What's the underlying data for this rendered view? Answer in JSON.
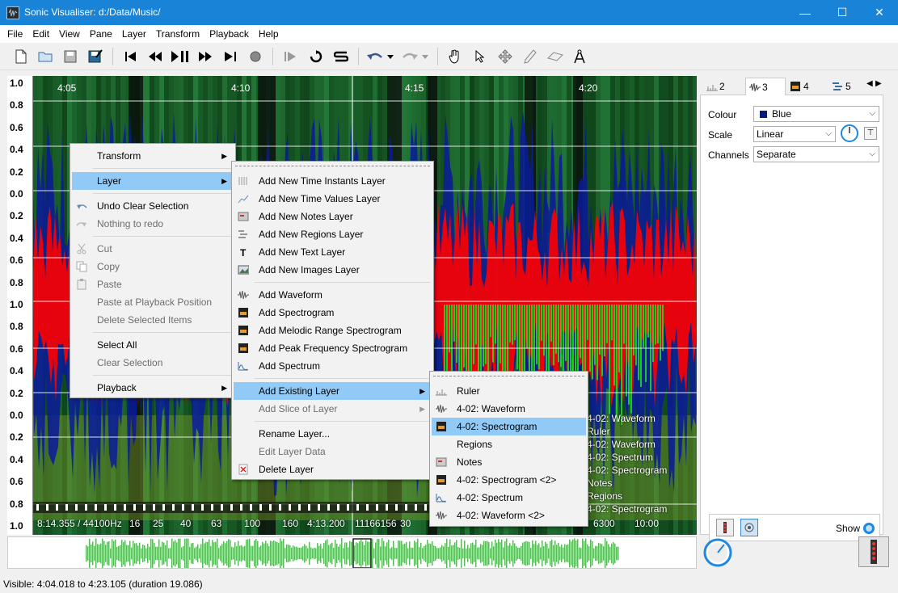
{
  "window": {
    "title": "Sonic Visualiser: d:/Data/Music/",
    "minimize": "—",
    "maximize": "☐",
    "close": "✕"
  },
  "menubar": [
    "File",
    "Edit",
    "View",
    "Pane",
    "Layer",
    "Transform",
    "Playback",
    "Help"
  ],
  "pane": {
    "time_labels": [
      "4:05",
      "4:10",
      "4:15",
      "4:20"
    ],
    "vruler_ticks": [
      "1.0",
      "0.8",
      "0.6",
      "0.4",
      "0.2",
      "0.0",
      "0.2",
      "0.4",
      "0.6",
      "0.8",
      "1.0",
      "0.8",
      "0.6",
      "0.4",
      "0.2",
      "0.0",
      "0.2",
      "0.4",
      "0.6",
      "0.8",
      "1.0"
    ],
    "bottom_readout": "8:14.355 / 44100Hz",
    "bottom_freqs": [
      "16",
      "25",
      "40",
      "63",
      "100",
      "160"
    ],
    "bottom_time": "4:13.200",
    "bottom_samples": "11166156",
    "bottom_tail": "30",
    "bottom_right": "6300",
    "bottom_right2": "10:00",
    "layer_labels_overlay": [
      "4-02: Waveform",
      "Ruler",
      "4-02: Waveform",
      "4-02: Spectrum",
      "4-02: Spectrogram",
      "Notes",
      "Regions",
      "4-02: Spectrogram"
    ]
  },
  "right_panel": {
    "tabs": [
      "2",
      "3",
      "4",
      "5"
    ],
    "colour_label": "Colour",
    "colour_value": "Blue",
    "scale_label": "Scale",
    "scale_value": "Linear",
    "channels_label": "Channels",
    "channels_value": "Separate",
    "show_label": "Show"
  },
  "status": "Visible: 4:04.018 to 4:23.105 (duration 19.086)",
  "context_menu": {
    "items": [
      "Transform",
      "Layer",
      "Undo Clear Selection",
      "Nothing to redo",
      "Cut",
      "Copy",
      "Paste",
      "Paste at Playback Position",
      "Delete Selected Items",
      "Select All",
      "Clear Selection",
      "Playback"
    ]
  },
  "layer_menu": {
    "items": [
      "Add New Time Instants Layer",
      "Add New Time Values Layer",
      "Add New Notes Layer",
      "Add New Regions Layer",
      "Add New Text Layer",
      "Add New Images Layer",
      "Add Waveform",
      "Add Spectrogram",
      "Add Melodic Range Spectrogram",
      "Add Peak Frequency Spectrogram",
      "Add Spectrum",
      "Add Existing Layer",
      "Add Slice of Layer",
      "Rename Layer...",
      "Edit Layer Data",
      "Delete Layer"
    ]
  },
  "existing_menu": {
    "items": [
      "Ruler",
      "4-02: Waveform",
      "4-02: Spectrogram",
      "Regions",
      "Notes",
      "4-02: Spectrogram <2>",
      "4-02: Spectrum",
      "4-02: Waveform <2>"
    ]
  },
  "colors": {
    "titlebar": "#1883d7",
    "highlight": "#91c9f7",
    "waveform_blue": "#0a1a9a",
    "spectrogram_red": "#ff0000",
    "spectrogram_green": "#22dd22",
    "overview_green": "#5cb85c"
  }
}
